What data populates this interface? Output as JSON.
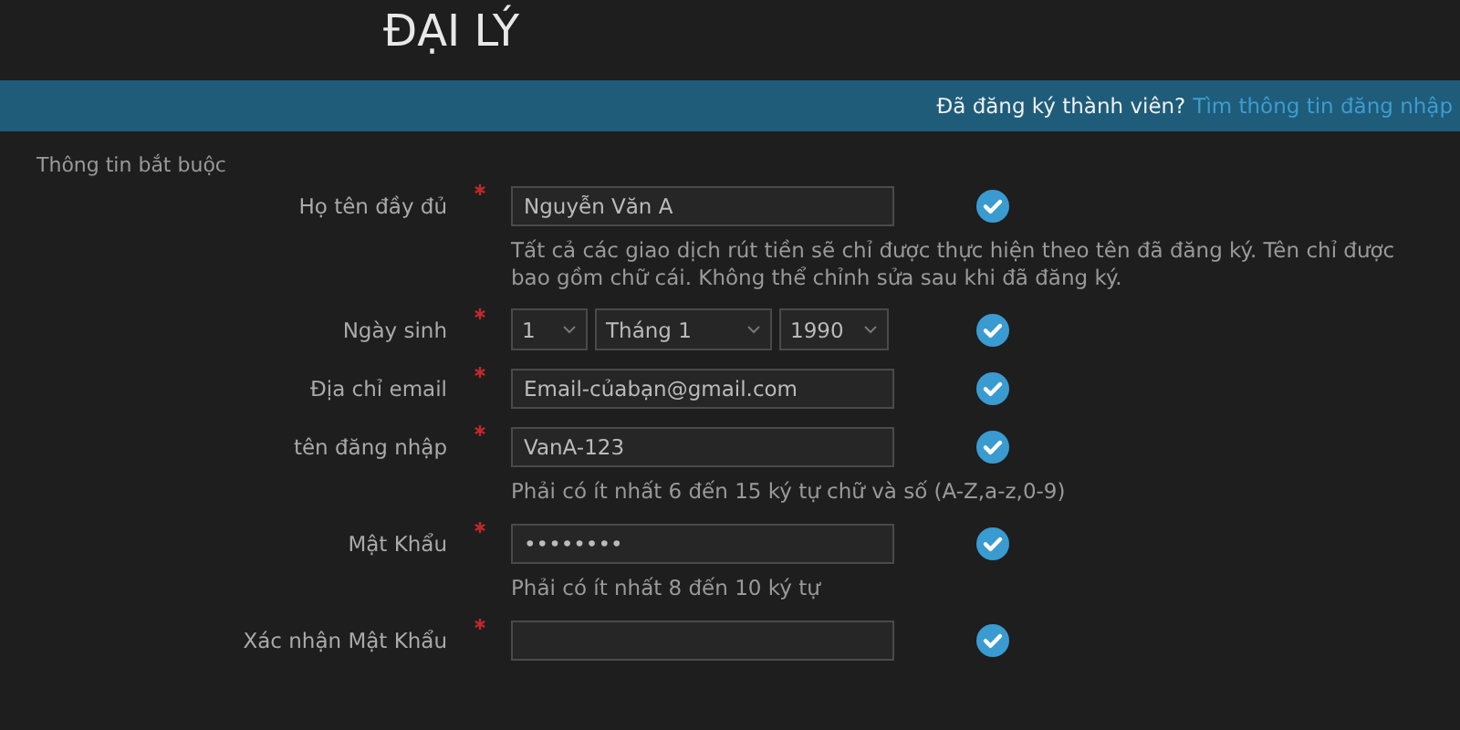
{
  "page_title": "ĐẠI LÝ",
  "banner": {
    "question": "Đã đăng ký thành viên?",
    "link": "Tìm thông tin đăng nhập"
  },
  "section_label": "Thông tin bắt buộc",
  "fields": [
    {
      "kind": "text",
      "label": "Họ tên đầy đủ",
      "required": true,
      "value": "Nguyễn Văn A",
      "valid": true,
      "hint": "Tất cả các giao dịch rút tiền sẽ chỉ được thực hiện theo tên đã đăng ký. Tên chỉ được bao gồm chữ cái. Không thể chỉnh sửa sau khi đã đăng ký."
    },
    {
      "kind": "date",
      "label": "Ngày sinh",
      "required": true,
      "selects": [
        "1",
        "Tháng 1",
        "1990"
      ],
      "valid": true
    },
    {
      "kind": "text",
      "label": "Địa chỉ email",
      "required": true,
      "value": "Email-củabạn@gmail.com",
      "valid": true
    },
    {
      "kind": "text",
      "label": "tên đăng nhập",
      "required": true,
      "value": "VanA-123",
      "valid": true,
      "hint": "Phải có ít nhất 6 đến 15 ký tự chữ và số (A-Z,a-z,0-9)"
    },
    {
      "kind": "password",
      "label": "Mật Khẩu",
      "required": true,
      "value": "••••••••",
      "valid": true,
      "hint": "Phải có ít nhất 8 đến 10 ký tự"
    },
    {
      "kind": "password",
      "label": "Xác nhận Mật Khẩu",
      "required": true,
      "valid": true
    }
  ]
}
